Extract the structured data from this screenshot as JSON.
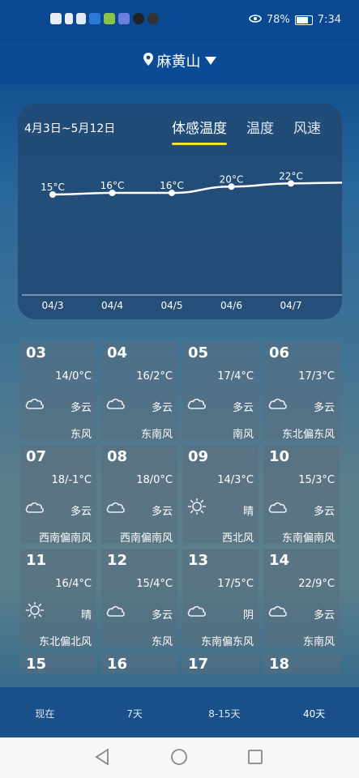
{
  "status": {
    "battery": "78%",
    "time": "7:34"
  },
  "location": {
    "name": "麻黄山",
    "dropdown_icon": "triangle-down-icon",
    "pin_icon": "location-pin-icon"
  },
  "chart_panel": {
    "date_range": "4月3日~5月12日",
    "tabs": [
      "体感温度",
      "温度",
      "风速"
    ],
    "active_tab": 0
  },
  "chart_data": {
    "type": "line",
    "x": [
      "04/3",
      "04/4",
      "04/5",
      "04/6",
      "04/7"
    ],
    "values": [
      15,
      16,
      16,
      20,
      22
    ],
    "data_labels": [
      "15°C",
      "16°C",
      "16°C",
      "20°C",
      "22°C"
    ],
    "grid": false
  },
  "days": [
    {
      "day": "03",
      "temp": "14/0°C",
      "icon": "cloudy-icon",
      "cond": "多云",
      "wind": "东风"
    },
    {
      "day": "04",
      "temp": "16/2°C",
      "icon": "cloudy-icon",
      "cond": "多云",
      "wind": "东南风"
    },
    {
      "day": "05",
      "temp": "17/4°C",
      "icon": "cloudy-icon",
      "cond": "多云",
      "wind": "南风"
    },
    {
      "day": "06",
      "temp": "17/3°C",
      "icon": "cloudy-icon",
      "cond": "多云",
      "wind": "东北偏东风"
    },
    {
      "day": "07",
      "temp": "18/-1°C",
      "icon": "cloudy-icon",
      "cond": "多云",
      "wind": "西南偏南风"
    },
    {
      "day": "08",
      "temp": "18/0°C",
      "icon": "cloudy-icon",
      "cond": "多云",
      "wind": "西南偏南风"
    },
    {
      "day": "09",
      "temp": "14/3°C",
      "icon": "sunny-icon",
      "cond": "晴",
      "wind": "西北风"
    },
    {
      "day": "10",
      "temp": "15/3°C",
      "icon": "cloudy-icon",
      "cond": "多云",
      "wind": "东南偏南风"
    },
    {
      "day": "11",
      "temp": "16/4°C",
      "icon": "sunny-icon",
      "cond": "晴",
      "wind": "东北偏北风"
    },
    {
      "day": "12",
      "temp": "15/4°C",
      "icon": "cloudy-icon",
      "cond": "多云",
      "wind": "东风"
    },
    {
      "day": "13",
      "temp": "17/5°C",
      "icon": "cloudy-icon",
      "cond": "阴",
      "wind": "东南偏东风"
    },
    {
      "day": "14",
      "temp": "22/9°C",
      "icon": "cloudy-icon",
      "cond": "多云",
      "wind": "东南风"
    },
    {
      "day": "15"
    },
    {
      "day": "16"
    },
    {
      "day": "17"
    },
    {
      "day": "18"
    }
  ],
  "bottom_nav": [
    "现在",
    "7天",
    "8-15天",
    "40天"
  ],
  "bottom_nav_active": 3,
  "colors": {
    "accent_underline": "#f2e234",
    "header_bg": "#0b4a94"
  }
}
